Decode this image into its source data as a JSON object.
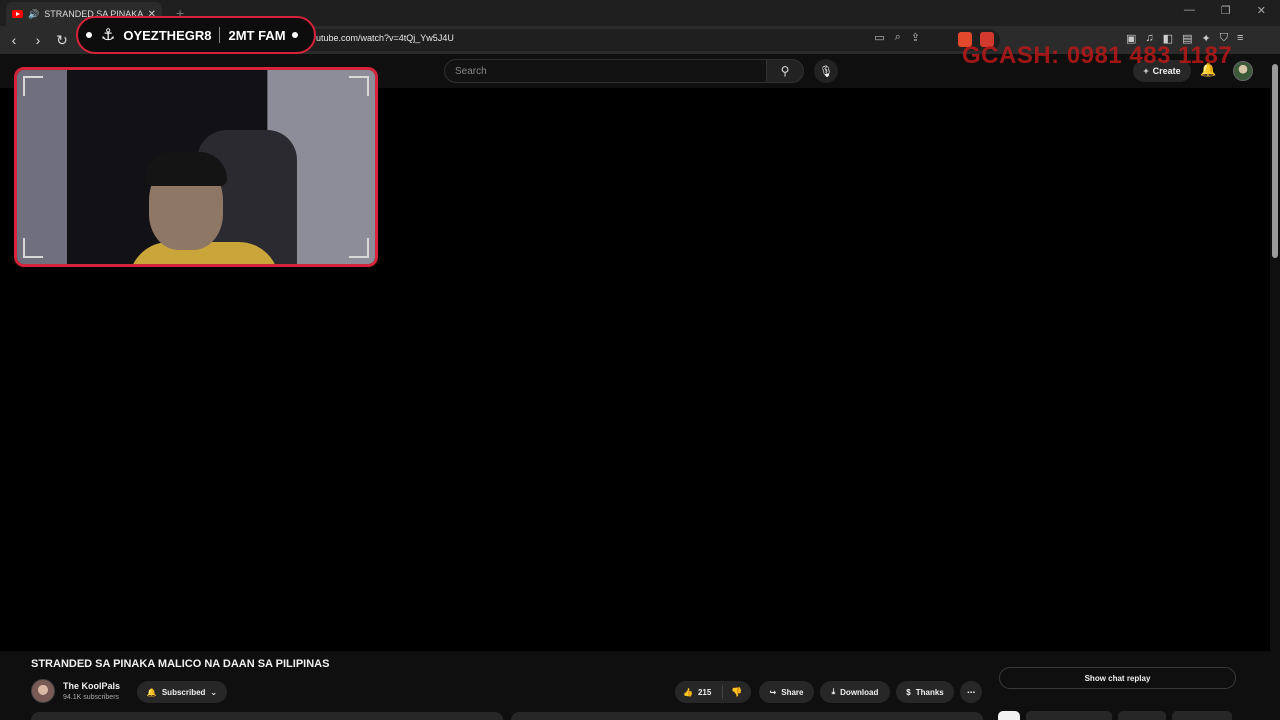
{
  "browser": {
    "tab_title": "STRANDED SA PINAKA MALICO NA DAAN SA PILIPINAS",
    "tab_close": "✕",
    "new_tab": "+",
    "url": "utube.com/watch?v=4tQj_Yw5J4U",
    "window_controls": [
      "—",
      "❐",
      "✕"
    ]
  },
  "overlay": {
    "handle": "OYEZTHEGR8",
    "tag": "2MT FAM",
    "gcash": "GCASH: 0981 483 1187",
    "accent_color": "#d4233a"
  },
  "youtube_header": {
    "search_placeholder": "Search",
    "create_label": "Create"
  },
  "video": {
    "title": "STRANDED SA PINAKA MALICO NA DAAN SA PILIPINAS",
    "channel_name": "The KoolPals",
    "subscribers": "94.1K subscribers",
    "subscribed_label": "Subscribed",
    "like_count": "215",
    "share_label": "Share",
    "download_label": "Download",
    "thanks_label": "Thanks",
    "chat_replay_label": "Show chat replay"
  },
  "icons": [
    "youtube-favicon",
    "speaker-icon",
    "back-icon",
    "forward-icon",
    "reload-icon",
    "anchor-icon",
    "search-icon",
    "mic-icon",
    "plus-icon",
    "bell-icon",
    "like-icon",
    "dislike-icon",
    "share-icon",
    "download-icon",
    "thanks-icon",
    "more-icon",
    "chevron-down-icon"
  ]
}
